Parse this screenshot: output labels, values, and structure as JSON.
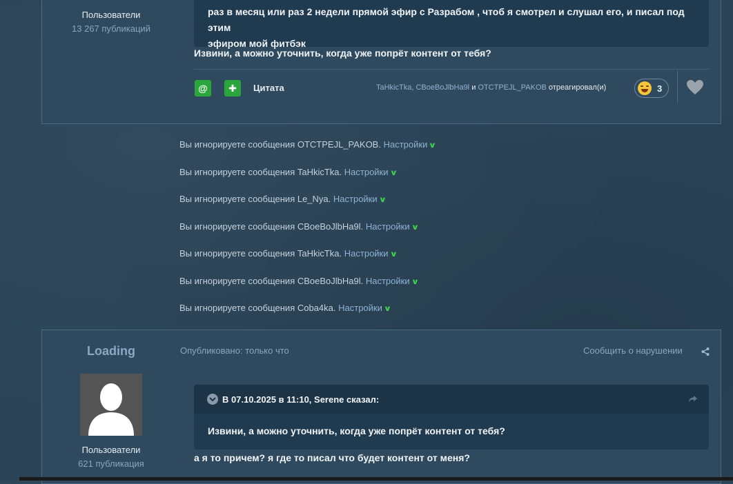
{
  "top_post": {
    "author_group": "Пользователи",
    "author_posts": "13 267 публикаций",
    "quote_lines": [
      "раз в месяц или раз 2 недели прямой эфир с Разрабом , чтоб я смотрел и слушал его, и писал под этим",
      "эфиром мой фитбэк"
    ],
    "body_text": "Извини, а можно уточнить, когда уже попрёт контент от тебя?",
    "quote_button": "Цитата",
    "reactors": [
      "TaHkicTka",
      "CBoeBoJlbHa9l",
      "OTCTPEJL_PAKOB"
    ],
    "reactors_and": "и",
    "reactors_verb": "отреагировал(и)",
    "reaction_count": "3"
  },
  "ignored": [
    {
      "text": "Вы игнорируете сообщения OTCTPEJL_PAKOB.",
      "link": "Настройки"
    },
    {
      "text": "Вы игнорируете сообщения TaHkicTka.",
      "link": "Настройки"
    },
    {
      "text": "Вы игнорируете сообщения Le_Nya.",
      "link": "Настройки"
    },
    {
      "text": "Вы игнорируете сообщения CBoeBoJlbHa9l.",
      "link": "Настройки"
    },
    {
      "text": "Вы игнорируете сообщения TaHkicTka.",
      "link": "Настройки"
    },
    {
      "text": "Вы игнорируете сообщения CBoeBoJlbHa9l.",
      "link": "Настройки"
    },
    {
      "text": "Вы игнорируете сообщения Coba4ka.",
      "link": "Настройки"
    }
  ],
  "bottom_post": {
    "username": "Loading",
    "author_group": "Пользователи",
    "author_posts": "621 публикация",
    "published": "Опубликовано: только что",
    "report": "Сообщить о нарушении",
    "quote_header": "В 07.10.2025 в 11:10, Serene сказал:",
    "quote_text": "Извини, а можно уточнить, когда уже попрёт контент от тебя?",
    "body_text": "а я то причем? я где то писал что будет контент от меня?"
  },
  "colors": {
    "accent_green": "#2aa63c",
    "link": "#8fb3d3",
    "background": "#2b4458"
  }
}
